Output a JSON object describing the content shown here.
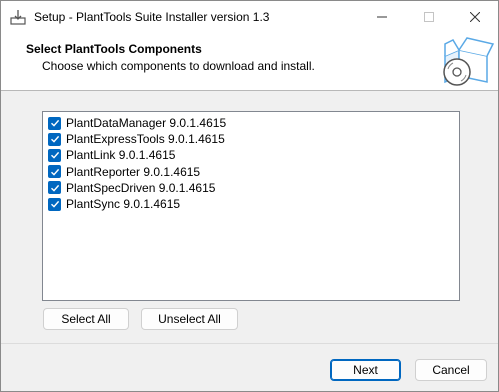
{
  "window": {
    "title": "Setup - PlantTools Suite Installer version 1.3"
  },
  "header": {
    "title": "Select PlantTools Components",
    "subtitle": "Choose which components to download and install.",
    "graphic": "package-disc-icon"
  },
  "components": [
    {
      "label": "PlantDataManager 9.0.1.4615",
      "checked": true
    },
    {
      "label": "PlantExpressTools 9.0.1.4615",
      "checked": true
    },
    {
      "label": "PlantLink 9.0.1.4615",
      "checked": true
    },
    {
      "label": "PlantReporter 9.0.1.4615",
      "checked": true
    },
    {
      "label": "PlantSpecDriven 9.0.1.4615",
      "checked": true
    },
    {
      "label": "PlantSync 9.0.1.4615",
      "checked": true
    }
  ],
  "buttons": {
    "select_all": "Select All",
    "unselect_all": "Unselect All",
    "next": "Next",
    "cancel": "Cancel"
  },
  "colors": {
    "accent": "#0067c0",
    "window_bg": "#f0f0f0",
    "header_bg": "#ffffff",
    "graphic_blue": "#5aa9e6"
  }
}
